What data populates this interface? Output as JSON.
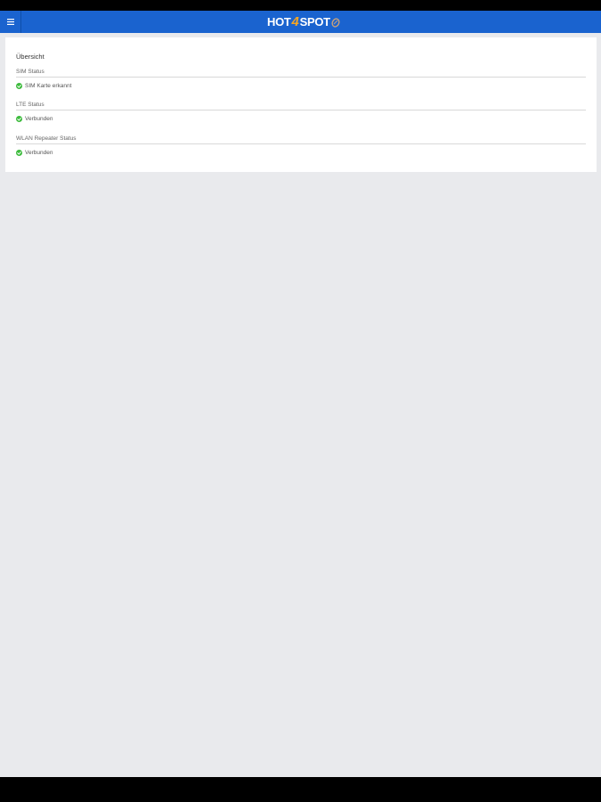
{
  "header": {
    "menu_icon": "hamburger-menu-icon",
    "logo": {
      "part1": "HOT",
      "part2": "4",
      "part3": "SPOT"
    },
    "background_color": "#1a63cf"
  },
  "overview": {
    "title": "Übersicht",
    "sections": [
      {
        "label": "SIM Status",
        "status_icon": "check-circle-icon",
        "status_text": "SIM Karte erkannt",
        "status_color": "#3dbb3d"
      },
      {
        "label": "LTE Status",
        "status_icon": "check-circle-icon",
        "status_text": "Verbunden",
        "status_color": "#3dbb3d"
      },
      {
        "label": "WLAN Repeater Status",
        "status_icon": "check-circle-icon",
        "status_text": "Verbunden",
        "status_color": "#3dbb3d"
      }
    ]
  }
}
